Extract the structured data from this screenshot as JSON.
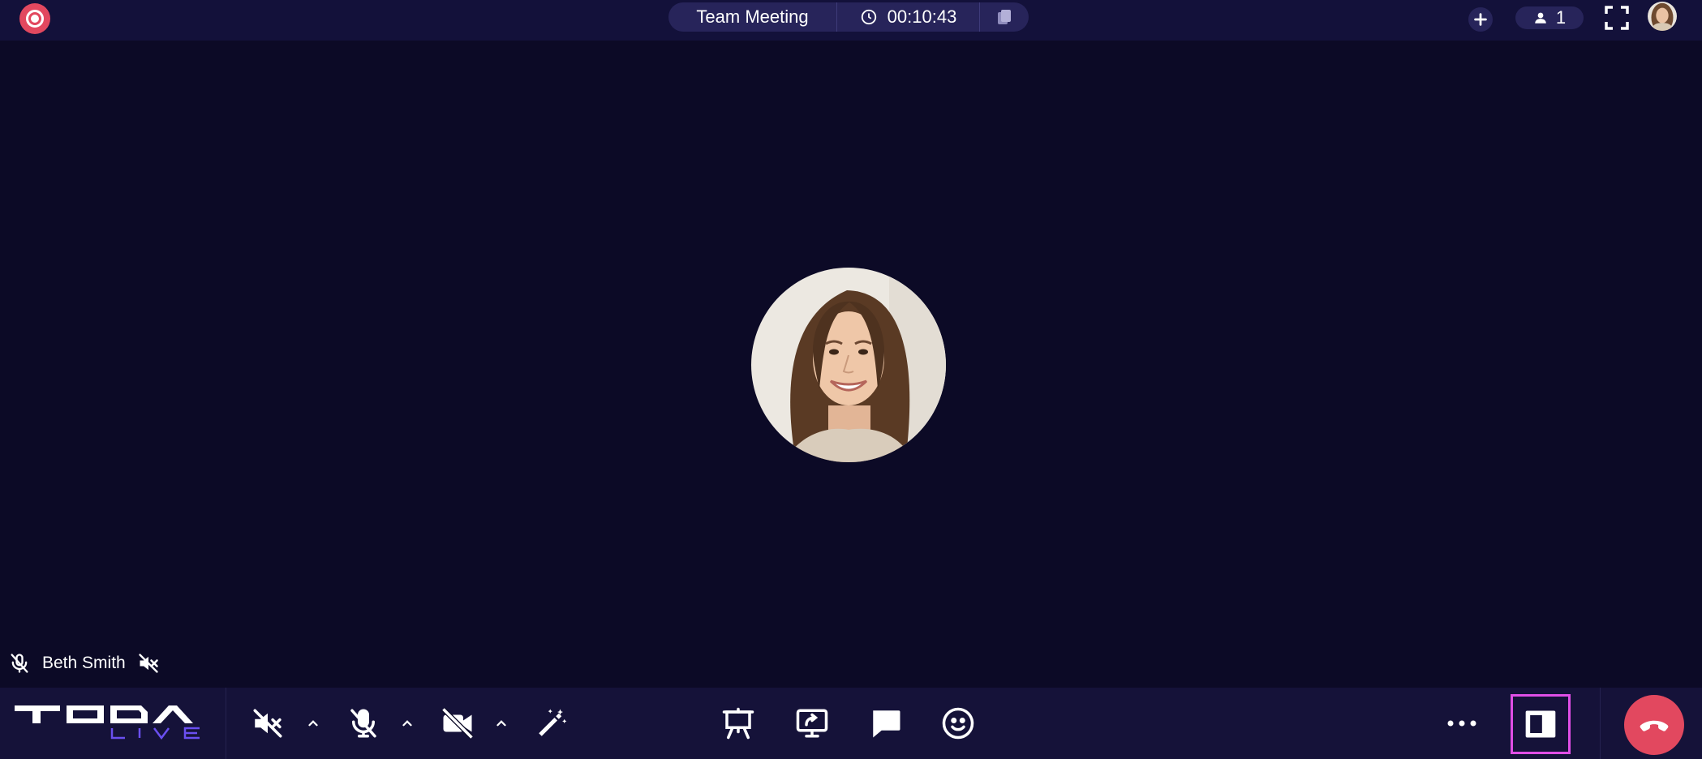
{
  "meeting": {
    "title": "Team Meeting",
    "elapsed": "00:10:43",
    "participant_count": "1"
  },
  "participant": {
    "name": "Beth Smith"
  },
  "brand": {
    "logo_text": "TODA",
    "logo_subtext": "LIVE"
  },
  "colors": {
    "background": "#0c0a26",
    "bar": "#13113a",
    "pill": "#27245a",
    "accent_red": "#e2485f",
    "highlight_magenta": "#e04ee6",
    "logo_purple": "#6a4ff0"
  },
  "icons": {
    "record": "record-icon",
    "clock": "clock-icon",
    "copy": "copy-icon",
    "add": "plus-icon",
    "person": "person-icon",
    "fullscreen": "fullscreen-icon",
    "speaker_off": "speaker-muted-icon",
    "mic_off": "mic-muted-icon",
    "video_off": "video-off-icon",
    "effects": "magic-wand-icon",
    "whiteboard": "whiteboard-icon",
    "screen_share": "screen-share-icon",
    "chat": "chat-icon",
    "reactions": "smiley-icon",
    "more": "more-dots-icon",
    "side_panel": "side-panel-icon",
    "hang_up": "hang-up-icon"
  }
}
